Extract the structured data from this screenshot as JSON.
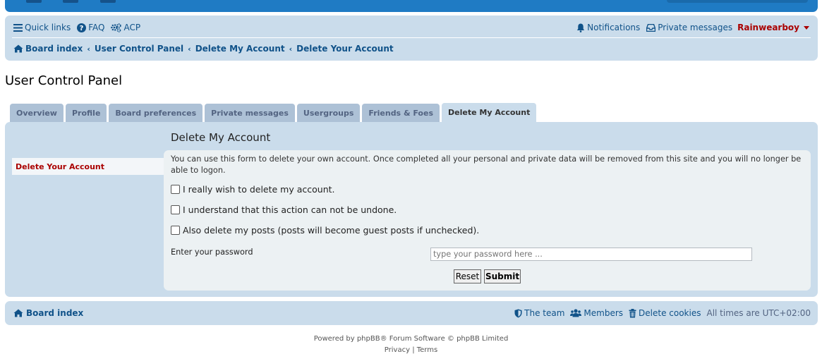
{
  "colors": {
    "header_blue": "#1f7bc4",
    "nav_bg": "#cadceb",
    "link": "#105289",
    "username": "#aa0000",
    "tab_bg": "#adc1d6",
    "content_bg": "#ecf1f3"
  },
  "navbar": {
    "quick_links": "Quick links",
    "faq": "FAQ",
    "acp": "ACP",
    "notifications": "Notifications",
    "private_messages": "Private messages",
    "username": "Rainwearboy"
  },
  "breadcrumbs": [
    "Board index",
    "User Control Panel",
    "Delete My Account",
    "Delete Your Account"
  ],
  "page_title": "User Control Panel",
  "tabs": [
    {
      "label": "Overview",
      "active": false
    },
    {
      "label": "Profile",
      "active": false
    },
    {
      "label": "Board preferences",
      "active": false
    },
    {
      "label": "Private messages",
      "active": false
    },
    {
      "label": "Usergroups",
      "active": false
    },
    {
      "label": "Friends & Foes",
      "active": false
    },
    {
      "label": "Delete My Account",
      "active": true
    }
  ],
  "side_menu": {
    "active_item": "Delete Your Account"
  },
  "form": {
    "heading": "Delete My Account",
    "description": "You can use this form to delete your own account. Once completed all your personal and private data will be removed from this site and you will no longer be able to logon.",
    "checkboxes": [
      {
        "label": "I really wish to delete my account.",
        "checked": false
      },
      {
        "label": "I understand that this action can not be undone.",
        "checked": false
      },
      {
        "label": "Also delete my posts (posts will become guest posts if unchecked).",
        "checked": false
      }
    ],
    "password_label": "Enter your password",
    "password_placeholder": "type your password here ...",
    "reset_label": "Reset",
    "submit_label": "Submit"
  },
  "footer": {
    "board_index": "Board index",
    "the_team": "The team",
    "members": "Members",
    "delete_cookies": "Delete cookies",
    "timezone": "All times are UTC+02:00",
    "powered_by": "Powered by phpBB® Forum Software © phpBB Limited",
    "privacy": "Privacy",
    "links_separator": "|",
    "terms": "Terms"
  }
}
